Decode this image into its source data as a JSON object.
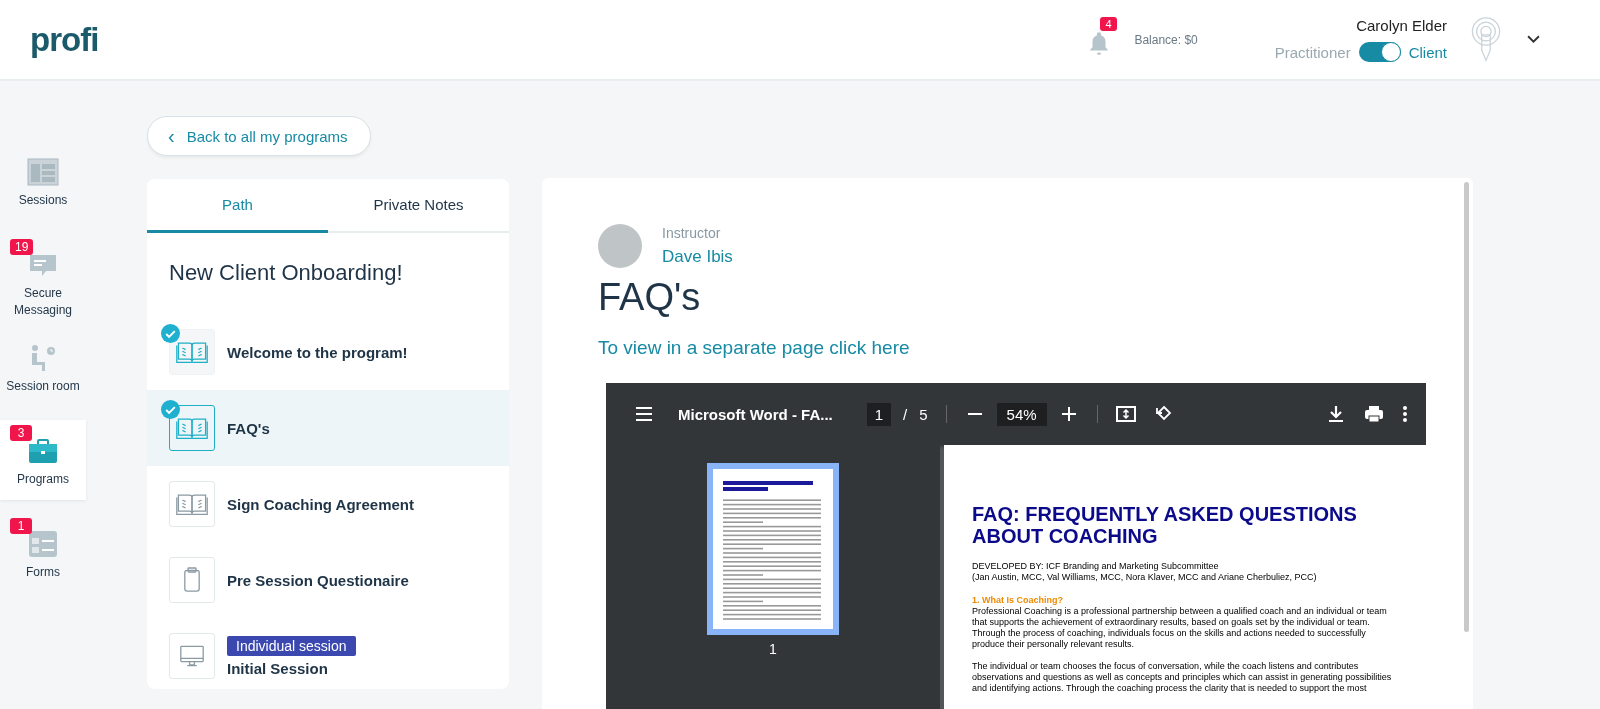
{
  "header": {
    "logo": "profi",
    "notifications": {
      "count": "4"
    },
    "balance": "Balance: $0",
    "user": {
      "name": "Carolyn Elder",
      "role_left": "Practitioner",
      "role_right": "Client",
      "client_mode": true
    }
  },
  "sidebar": {
    "items": [
      {
        "kind": "sessions",
        "label": "Sessions",
        "selected": false
      },
      {
        "kind": "messaging",
        "label": "Secure Messaging",
        "badge": "19",
        "selected": false
      },
      {
        "kind": "session-room",
        "label": "Session room",
        "selected": false
      },
      {
        "kind": "programs",
        "label": "Programs",
        "badge": "3",
        "selected": true
      },
      {
        "kind": "forms",
        "label": "Forms",
        "badge": "1",
        "selected": false
      }
    ]
  },
  "back_button": {
    "icon": "‹",
    "label": "Back to all my programs"
  },
  "program": {
    "tabs": [
      {
        "label": "Path",
        "selected": true
      },
      {
        "label": "Private Notes",
        "selected": false
      }
    ],
    "title": "New Client Onboarding!",
    "steps": [
      {
        "kind": "book",
        "label": "Welcome to the program!",
        "completed": true,
        "selected": false
      },
      {
        "kind": "book",
        "label": "FAQ's",
        "completed": true,
        "selected": true
      },
      {
        "kind": "book",
        "label": "Sign Coaching Agreement",
        "completed": false,
        "selected": false
      },
      {
        "kind": "clipboard",
        "label": "Pre Session Questionaire",
        "completed": false,
        "selected": false
      },
      {
        "kind": "monitor",
        "tag": "Individual session",
        "label": "Initial Session",
        "completed": false,
        "selected": false
      }
    ]
  },
  "content": {
    "instructor_label": "Instructor",
    "instructor_name": "Dave Ibis",
    "title": "FAQ's",
    "link": "To view in a separate page click here",
    "pdf_viewer": {
      "title": "Microsoft Word - FA...",
      "page": "1",
      "separator": "/",
      "total": "5",
      "zoom": "54%",
      "thumbnail_page": "1",
      "document": {
        "heading": "FAQ: FREQUENTLY ASKED QUESTIONS ABOUT COACHING",
        "credits": [
          "DEVELOPED BY: ICF Branding and Marketing Subcommittee",
          "(Jan Austin, MCC, Val Williams, MCC, Nora Klaver, MCC and Ariane Cherbuliez, PCC)"
        ],
        "section": "1. What Is Coaching?",
        "paragraphs": [
          [
            "Professional Coaching is a professional partnership between a qualified coach and an individual or team",
            "that supports the achievement of extraordinary results, based on goals set by the individual or team.",
            "Through the process of coaching, individuals focus on the skills and actions needed to successfully",
            "produce their personally relevant results."
          ],
          [
            "The individual or team chooses the focus of conversation, while the coach listens and contributes",
            "observations and questions as well as concepts and principles which can assist in generating possibilities",
            "and identifying actions. Through the coaching process the clarity that is needed to support the most"
          ]
        ]
      }
    }
  }
}
